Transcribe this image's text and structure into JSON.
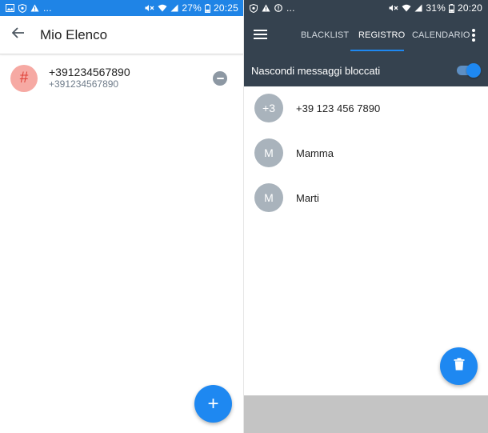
{
  "left": {
    "status_bar": {
      "icons": [
        "image-icon",
        "shield-icon",
        "warning-icon",
        "more-dots"
      ],
      "dots": "...",
      "battery": "27%",
      "time": "20:25"
    },
    "header": {
      "back_icon": "arrow-left-icon",
      "title": "Mio Elenco"
    },
    "contact": {
      "avatar": "#",
      "number": "+391234567890",
      "sub": "+391234567890"
    },
    "fab_label": "+"
  },
  "right": {
    "status_bar": {
      "dots": "...",
      "battery": "31%",
      "time": "20:20"
    },
    "tabs": [
      {
        "label": "BLACKLIST"
      },
      {
        "label": "REGISTRO",
        "active": true
      },
      {
        "label": "CALENDARIO"
      }
    ],
    "toggle": {
      "label": "Nascondi messaggi bloccati",
      "on": true
    },
    "log": [
      {
        "avatar": "+3",
        "name": "+39 123 456 7890"
      },
      {
        "avatar": "M",
        "name": "Mamma"
      },
      {
        "avatar": "M",
        "name": "Marti"
      }
    ]
  },
  "colors": {
    "accent": "#1e88f1",
    "left_statusbar": "#1f84e6",
    "dark_header": "#35424f",
    "avatar_pink": "#f6a9a3",
    "avatar_gray": "#a9b3bc"
  }
}
